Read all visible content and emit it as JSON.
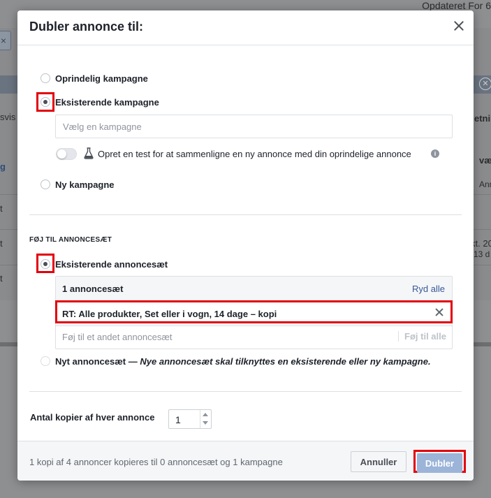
{
  "background": {
    "updated_text": "Opdateret For 6",
    "left_fragments": [
      "svis",
      "g",
      "t",
      "t",
      "t"
    ],
    "right_fragments": [
      "etni",
      "væ",
      "Ann",
      "kt. 20",
      "13 d"
    ],
    "close_glyph": "✕",
    "btn_glyph": "×"
  },
  "modal": {
    "title": "Dubler annonce til:",
    "campaign": {
      "option_original": "Oprindelig kampagne",
      "option_existing": "Eksisterende kampagne",
      "campaign_placeholder": "Vælg en kampagne",
      "test_toggle_label": "Opret en test for at sammenligne en ny annonce med din oprindelige annonce",
      "info_glyph": "i",
      "option_new": "Ny kampagne"
    },
    "adset": {
      "section_title": "FØJ TIL ANNONCESÆT",
      "option_existing": "Eksisterende annoncesæt",
      "count_label": "1 annoncesæt",
      "clear_all": "Ryd alle",
      "selected_item": "RT: Alle produkter, Set eller i vogn, 14 dage – kopi",
      "add_placeholder": "Føj til et andet annoncesæt",
      "add_button": "Føj til alle",
      "option_new_label": "Nyt annoncesæt —",
      "option_new_note": "Nye annoncesæt skal tilknyttes en eksisterende eller ny kampagne."
    },
    "copies": {
      "label": "Antal kopier af hver annonce",
      "value": "1"
    },
    "footer": {
      "summary": "1 kopi af 4 annoncer kopieres til 0 annoncesæt og 1 kampagne",
      "cancel": "Annuller",
      "duplicate": "Dubler"
    }
  },
  "colors": {
    "highlight": "#e3000b",
    "link": "#365899",
    "primary_disabled": "#9cb4d8"
  }
}
